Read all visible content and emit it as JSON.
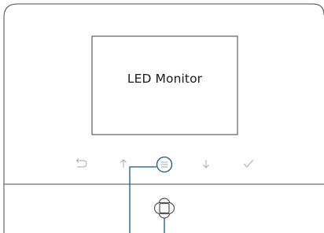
{
  "diagram": {
    "screen_label": "LED Monitor",
    "line_color": "#3f3f3f",
    "icon_color": "#a9a9a9",
    "callout_color": "#0b5a8a"
  },
  "buttons": [
    {
      "name": "back-button",
      "icon": "return-arrow-icon"
    },
    {
      "name": "up-button",
      "icon": "up-arrow-icon"
    },
    {
      "name": "menu-button",
      "icon": "menu-icon",
      "highlighted": true
    },
    {
      "name": "down-button",
      "icon": "down-arrow-icon"
    },
    {
      "name": "confirm-button",
      "icon": "checkmark-icon"
    }
  ],
  "joystick": {
    "icon": "joystick-icon"
  }
}
